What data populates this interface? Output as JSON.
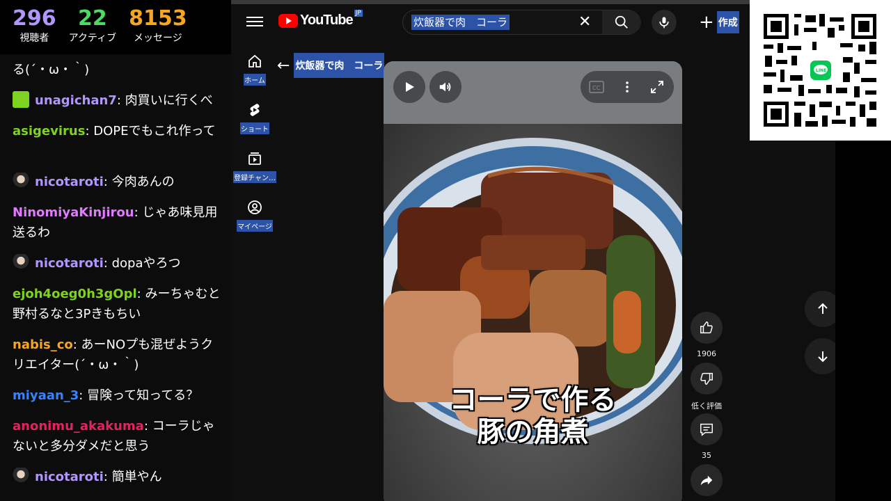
{
  "stats": [
    {
      "value": "296",
      "label": "視聴者",
      "color": "#b197fc"
    },
    {
      "value": "22",
      "label": "アクティブ",
      "color": "#4cd964"
    },
    {
      "value": "8153",
      "label": "メッセージ",
      "color": "#f5a623"
    }
  ],
  "chat": {
    "partial_line": "る(´・ω・｀)",
    "messages": [
      {
        "user": "unagichan7",
        "text": ": 肉買いに行くべ",
        "color": "#b197fc",
        "avatar": "gift"
      },
      {
        "user": "asigevirus",
        "text": ": DOPEでもこれ作って",
        "color": "#7ed321",
        "avatar": ""
      },
      {
        "user": "nicotaroti",
        "text": ": 今肉あんの",
        "color": "#b197fc",
        "avatar": "char"
      },
      {
        "user": "NinomiyaKinjirou",
        "text": ": じゃあ味見用送るわ",
        "color": "#e07bff",
        "avatar": ""
      },
      {
        "user": "nicotaroti",
        "text": ": dopaやろつ",
        "color": "#b197fc",
        "avatar": "char"
      },
      {
        "user": "ejoh4oeg0h3gOpl",
        "text": ": みーちゃむと野村るなと3Pきもちい",
        "color": "#7ed321",
        "avatar": ""
      },
      {
        "user": "nabis_co",
        "text": ": あーNOプも混ぜようクリエイター(´・ω・｀)",
        "color": "#f5a623",
        "avatar": ""
      },
      {
        "user": "miyaan_3",
        "text": ": 冒険って知ってる？",
        "color": "#3b82f6",
        "avatar": ""
      },
      {
        "user": "anonimu_akakuma",
        "text": ": コーラじゃないと多分ダメだと思う",
        "color": "#e0245e",
        "avatar": ""
      },
      {
        "user": "nicotaroti",
        "text": ": 簡単やん",
        "color": "#b197fc",
        "avatar": "char"
      }
    ]
  },
  "youtube": {
    "logo_text": "YouTube",
    "logo_region": "JP",
    "search_query": "炊飯器で肉　コーラ",
    "create_label": "作成",
    "sidebar": [
      {
        "label": "ホーム",
        "icon": "home-icon"
      },
      {
        "label": "ショート",
        "icon": "shorts-icon"
      },
      {
        "label": "登録チャン…",
        "icon": "subscriptions-icon"
      },
      {
        "label": "マイページ",
        "icon": "account-icon"
      }
    ],
    "back_title": "炊飯器で肉　コーラ",
    "video": {
      "caption_line1": "コーラで作る",
      "caption_line2": "豚の角煮"
    },
    "actions": {
      "likes": "1906",
      "dislike_label": "低く評価",
      "comments": "35"
    }
  }
}
